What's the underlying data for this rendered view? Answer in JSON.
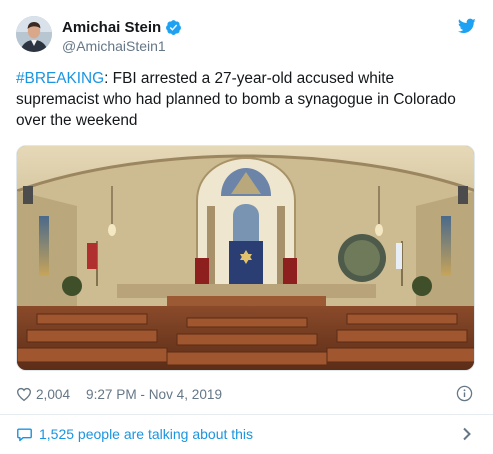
{
  "author": {
    "display_name": "Amichai Stein",
    "handle": "@AmichaiStein1",
    "verified_icon": "verified-badge-icon",
    "platform_icon": "twitter-bird-icon"
  },
  "tweet": {
    "hashtag": "#BREAKING",
    "text_after_hashtag": ": FBI arrested a 27-year-old accused white supremacist who had planned to bomb a synagogue in Colorado over the weekend"
  },
  "stats": {
    "likes": "2,004",
    "timestamp": "9:27 PM - Nov 4, 2019",
    "info_icon": "info-icon"
  },
  "conversation": {
    "label": "1,525 people are talking about this",
    "icon": "speech-bubble-icon"
  },
  "colors": {
    "accent": "#1b95e0",
    "text": "#14171a",
    "muted": "#657786",
    "divider": "#e6ecf0"
  }
}
